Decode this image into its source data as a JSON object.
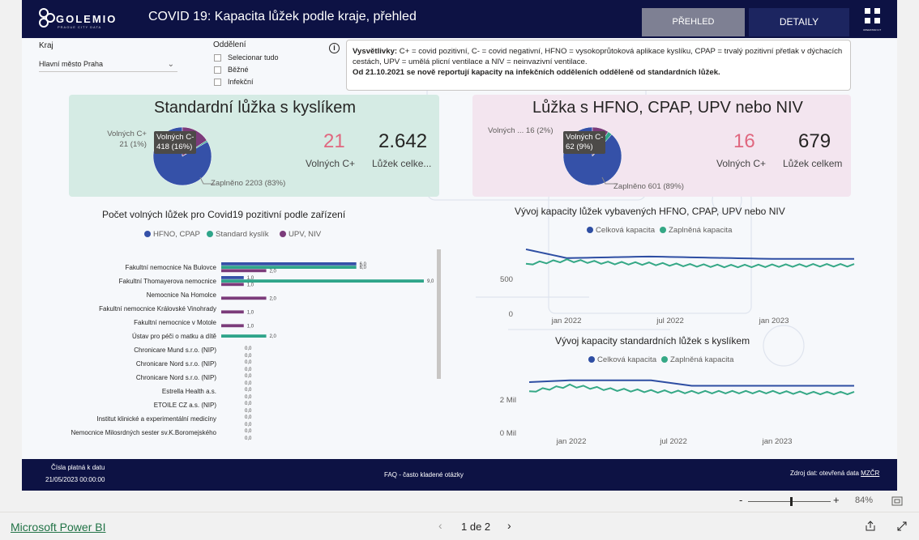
{
  "header": {
    "logo_text": "GOLEMIO",
    "logo_sub": "PRAGUE CITY DATA",
    "title": "COVID 19: Kapacita lůžek podle kraje, přehled",
    "tab_prehled": "PŘEHLED",
    "tab_detaily": "DETAILY",
    "oict_letters": [
      "O",
      "I",
      "C",
      "T"
    ],
    "oict_sub": "OPERATOR ICT"
  },
  "filters": {
    "kraj_label": "Kraj",
    "kraj_value": "Hlavní město Praha",
    "oddeleni_label": "Oddělení",
    "options": [
      "Selecionar tudo",
      "Běžné",
      "Infekční"
    ]
  },
  "legend_box": {
    "bold_prefix": "Vysvětlivky:",
    "text": " C+ = covid pozitivní, C- = covid negativní, HFNO = vysokoprůtoková aplikace kyslíku, CPAP = trvalý pozitivní přetlak v dýchacích cestách, UPV = umělá plicní ventilace a NIV = neinvazivní ventilace.",
    "bold_note": "Od 21.10.2021 se nově reportují kapacity na infekčních odděleních odděleně od standardních lůžek."
  },
  "card_standard": {
    "title": "Standardní lůžka s kyslíkem",
    "pie_label_cplus_a": "Volných C+",
    "pie_label_cplus_b": "21 (1%)",
    "tooltip_a": "Volných C-",
    "tooltip_b": "418 (16%)",
    "pie_label_occupied": "Zaplněno 2203 (83%)",
    "kpi_free": "21",
    "kpi_free_label": "Volných C+",
    "kpi_total": "2.642",
    "kpi_total_label": "Lůžek celke...",
    "pie": {
      "occupied": 2203,
      "free_cminus": 418,
      "free_cplus": 21
    }
  },
  "card_hfno": {
    "title": "Lůžka s HFNO, CPAP, UPV nebo NIV",
    "pie_label_cplus": "Volných ... 16 (2%)",
    "tooltip_a": "Volných C-",
    "tooltip_b": "62 (9%)",
    "pie_label_occupied": "Zaplněno 601 (89%)",
    "kpi_free": "16",
    "kpi_free_label": "Volných C+",
    "kpi_total": "679",
    "kpi_total_label": "Lůžek celkem",
    "pie": {
      "occupied": 601,
      "free_cminus": 62,
      "free_cplus": 16
    }
  },
  "colors": {
    "navy": "#0d1244",
    "pie_blue": "#3551a8",
    "pie_purple": "#7b3b7a",
    "pie_green": "#2fa58a",
    "kpi_pink": "#e0677f",
    "line_blue": "#2e4ea3",
    "line_green": "#35a886"
  },
  "chart_data": [
    {
      "type": "bar",
      "title": "Počet volných lůžek pro Covid19 pozitivní podle zařízení",
      "orientation": "horizontal",
      "categories": [
        "Fakultní nemocnice Na Bulovce",
        "Fakultní Thomayerova nemocnice",
        "Nemocnice Na Homolce",
        "Fakultní nemocnice Královské Vinohrady",
        "Fakultní nemocnice v Motole",
        "Ústav pro péči o matku a dítě",
        "Chronicare Mund s.r.o. (NIP)",
        "Chronicare Nord s.r.o. (NIP)",
        "Chronicare Nord s.r.o. (NIP)",
        "Estrella Health a.s.",
        "ETOILE CZ a.s. (NIP)",
        "Institut klinické a experimentální medicíny",
        "Nemocnice Milosrdných sester sv.K.Boromejského"
      ],
      "series": [
        {
          "name": "HFNO, CPAP",
          "values": [
            6,
            1,
            0,
            0,
            0,
            0,
            0,
            0,
            0,
            0,
            0,
            0,
            0
          ]
        },
        {
          "name": "Standard kyslík",
          "values": [
            6,
            9,
            0,
            0,
            0,
            2,
            0,
            0,
            0,
            0,
            0,
            0,
            0
          ]
        },
        {
          "name": "UPV, NIV",
          "values": [
            2,
            1,
            2,
            1,
            1,
            0,
            0,
            0,
            0,
            0,
            0,
            0,
            0
          ]
        }
      ],
      "data_labels": [
        "6,0",
        "2,0",
        "9,0",
        "1,0",
        "1,0",
        "2,0",
        "1,0",
        "1,0",
        "0,0",
        "2,0",
        "0,0",
        "0,0",
        "0,0",
        "0,0",
        "0,0",
        "0,0",
        "0,0",
        "0,0",
        "0,0",
        "0,0"
      ],
      "xlim": [
        0,
        9
      ],
      "legend": "top"
    },
    {
      "type": "line",
      "title": "Vývoj kapacity lůžek vybavených HFNO, CPAP, UPV nebo NIV",
      "x_ticks": [
        "jan 2022",
        "jul 2022",
        "jan 2023"
      ],
      "y_ticks": [
        "0",
        "500"
      ],
      "ylim": [
        0,
        850
      ],
      "x": [
        "2021-10",
        "2021-11",
        "2022-01",
        "2022-03",
        "2022-06",
        "2022-09",
        "2022-12",
        "2023-03",
        "2023-05"
      ],
      "series": [
        {
          "name": "Celková kapacita",
          "values": [
            800,
            690,
            700,
            710,
            700,
            690,
            680,
            680,
            680
          ]
        },
        {
          "name": "Zaplněná kapacita",
          "values": [
            620,
            660,
            630,
            620,
            600,
            590,
            595,
            600,
            600
          ]
        }
      ],
      "legend": "top"
    },
    {
      "type": "line",
      "title": "Vývoj kapacity standardních lůžek s kyslíkem",
      "x_ticks": [
        "jan 2022",
        "jul 2022",
        "jan 2023"
      ],
      "y_ticks": [
        "0 Mil",
        "2 Mil"
      ],
      "ylim": [
        0,
        3200000
      ],
      "x": [
        "2021-10",
        "2021-12",
        "2022-02",
        "2022-05",
        "2022-06",
        "2022-09",
        "2022-12",
        "2023-03",
        "2023-05"
      ],
      "series": [
        {
          "name": "Celková kapacita",
          "values": [
            2800000,
            2900000,
            2900000,
            2900000,
            2600000,
            2600000,
            2600000,
            2600000,
            2600000
          ]
        },
        {
          "name": "Zaplněná kapacita",
          "values": [
            2300000,
            2600000,
            2400000,
            2300000,
            2250000,
            2250000,
            2250000,
            2200000,
            2200000
          ]
        }
      ],
      "legend": "top"
    }
  ],
  "footer": {
    "date_label": "Čísla platná k datu",
    "date_value": "21/05/2023 00:00:00",
    "faq": "FAQ - často kladené otázky",
    "source_prefix": "Zdroj dat: otevřená data ",
    "source_link": "MZČR"
  },
  "viewer": {
    "zoom_minus": "-",
    "zoom_plus": "+",
    "zoom_level": "84%",
    "zoom_fraction": 0.5,
    "brand": "Microsoft Power BI",
    "page_indicator": "1 de 2"
  }
}
